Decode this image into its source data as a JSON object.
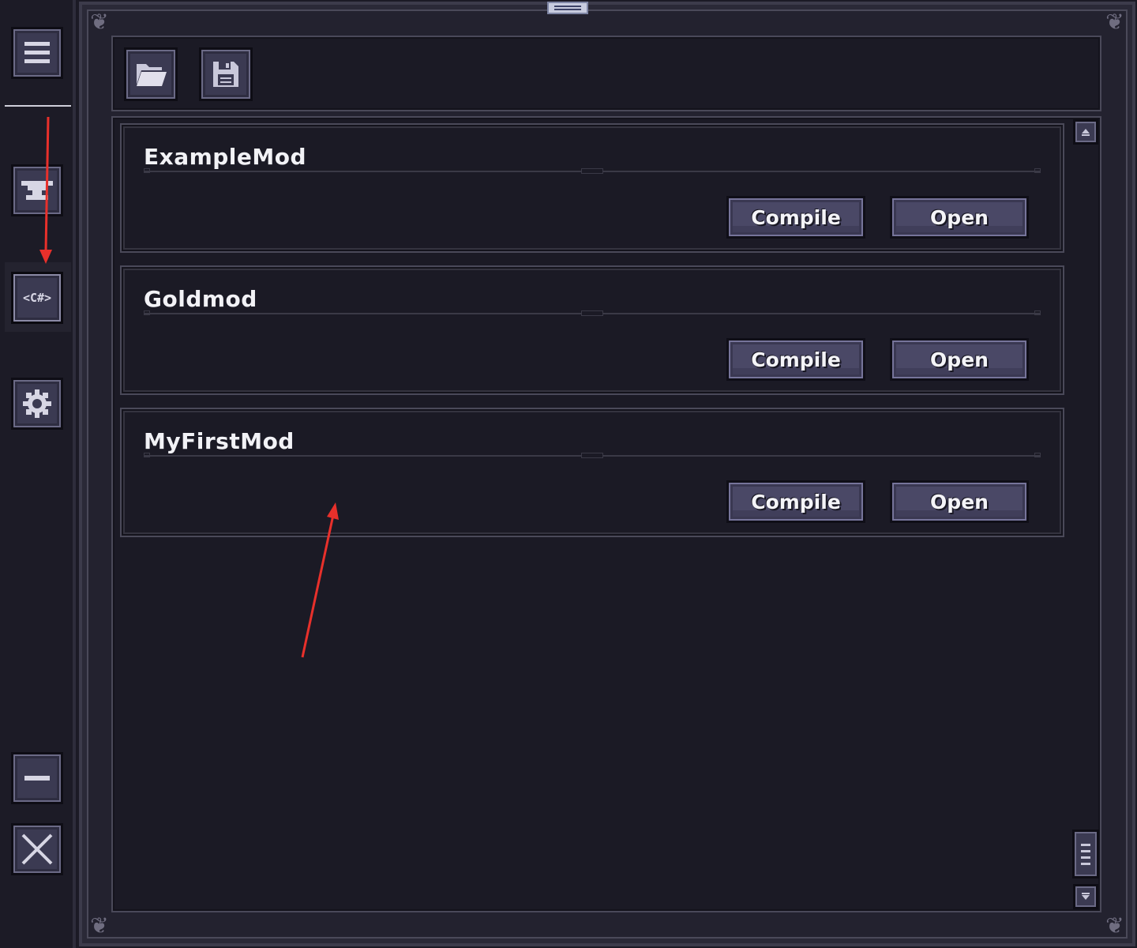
{
  "sidebar": {
    "menu_icon": "hamburger-menu-icon",
    "nav_icon_1": "anvil-icon",
    "nav_icon_2": "csharp-code-icon",
    "nav_icon_2_text": "<C#>",
    "settings_icon": "gear-icon",
    "minimize_icon": "minimize-icon",
    "close_icon": "close-x-icon"
  },
  "toolbar": {
    "open_folder_icon": "folder-open-icon",
    "save_icon": "floppy-disk-icon"
  },
  "mods": [
    {
      "name": "ExampleMod",
      "compile_label": "Compile",
      "open_label": "Open"
    },
    {
      "name": "Goldmod",
      "compile_label": "Compile",
      "open_label": "Open"
    },
    {
      "name": "MyFirstMod",
      "compile_label": "Compile",
      "open_label": "Open"
    }
  ],
  "colors": {
    "background": "#1b1a25",
    "button_face": "#4a4866",
    "text": "#f2f2f6",
    "annotation_arrow": "#e8302b"
  }
}
